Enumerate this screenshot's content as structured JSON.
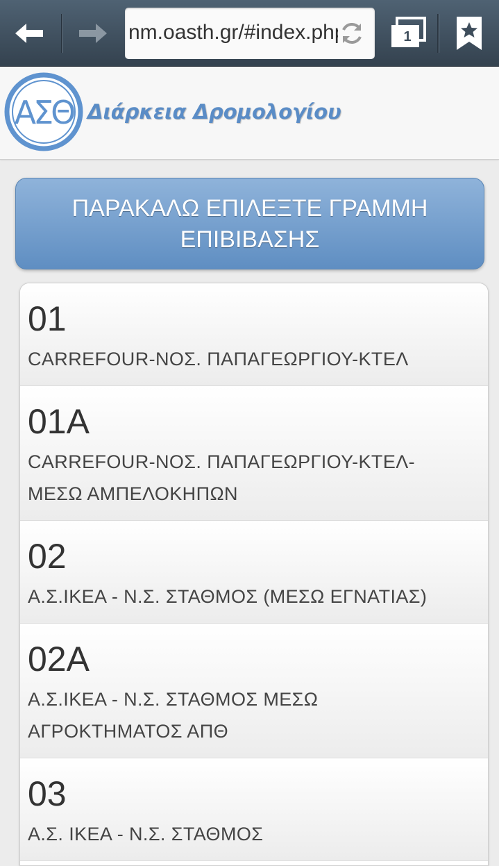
{
  "browser": {
    "url": "nm.oasth.gr/#index.php",
    "tab_count": "1"
  },
  "header": {
    "title": "Διάρκεια Δρομολογίου",
    "logo_text": "ΑΣΘ"
  },
  "main": {
    "prompt": "ΠΑΡΑΚΑΛΩ ΕΠΙΛΕΞΤΕ ΓΡΑΜΜΗ ΕΠΙΒΙΒΑΣΗΣ",
    "lines": [
      {
        "code": "01",
        "name": "CARREFOUR-ΝΟΣ. ΠΑΠΑΓΕΩΡΓΙΟΥ-ΚΤΕΛ"
      },
      {
        "code": "01Α",
        "name": "CARREFOUR-ΝΟΣ. ΠΑΠΑΓΕΩΡΓΙΟΥ-ΚΤΕΛ-ΜΕΣΩ ΑΜΠΕΛΟΚΗΠΩΝ"
      },
      {
        "code": "02",
        "name": "Α.Σ.ΙΚΕΑ - Ν.Σ. ΣΤΑΘΜΟΣ (ΜΕΣΩ ΕΓΝΑΤΙΑΣ)"
      },
      {
        "code": "02Α",
        "name": "Α.Σ.ΙΚΕΑ - Ν.Σ. ΣΤΑΘΜΟΣ ΜΕΣΩ ΑΓΡΟΚΤΗΜΑΤΟΣ ΑΠΘ"
      },
      {
        "code": "03",
        "name": "Α.Σ. ΙΚΕΑ - Ν.Σ. ΣΤΑΘΜΟΣ"
      }
    ]
  },
  "colors": {
    "accent": "#5a8cc6",
    "toolbar": "#3e4d5b"
  }
}
